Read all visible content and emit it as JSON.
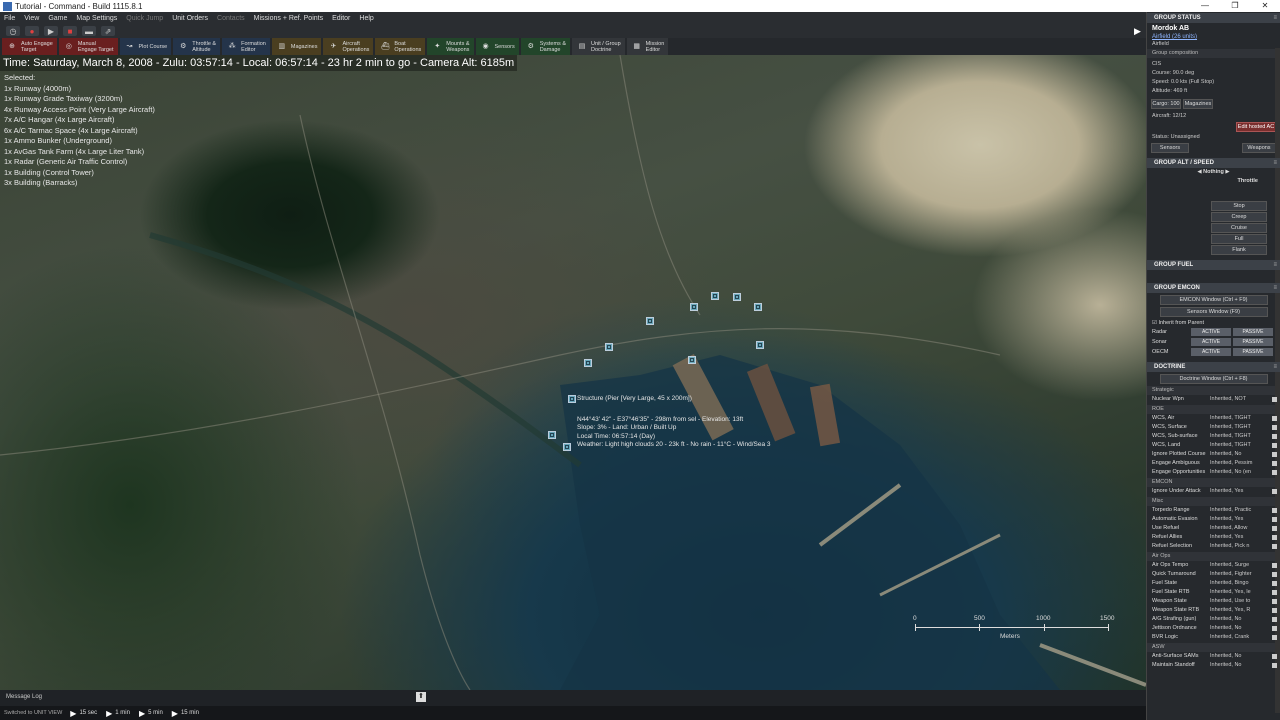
{
  "window": {
    "title": "Tutorial - Command - Build 1115.8.1",
    "controls": [
      "—",
      "❐",
      "✕"
    ]
  },
  "menu": [
    "File",
    "View",
    "Game",
    "Map Settings",
    "Quick Jump",
    "Unit Orders",
    "Contacts",
    "Missions + Ref. Points",
    "Editor",
    "Help"
  ],
  "toolbar": {
    "buttons": [
      {
        "l1": "Auto Engage",
        "l2": "Target",
        "style": "red",
        "icon": "crosshair-icon"
      },
      {
        "l1": "Manual",
        "l2": "Engage Target",
        "style": "red",
        "icon": "target-icon"
      },
      {
        "l1": "Plot Course",
        "l2": "",
        "style": "blue",
        "icon": "course-icon"
      },
      {
        "l1": "Throttle &",
        "l2": "Altitude",
        "style": "blue",
        "icon": "throttle-icon"
      },
      {
        "l1": "Formation",
        "l2": "Editor",
        "style": "blue",
        "icon": "formation-icon"
      },
      {
        "l1": "Magazines",
        "l2": "",
        "style": "brown",
        "icon": "magazine-icon"
      },
      {
        "l1": "Aircraft",
        "l2": "Operations",
        "style": "brown",
        "icon": "aircraft-icon"
      },
      {
        "l1": "Boat",
        "l2": "Operations",
        "style": "brown",
        "icon": "boat-icon"
      },
      {
        "l1": "Mounts &",
        "l2": "Weapons",
        "style": "green",
        "icon": "weapons-icon"
      },
      {
        "l1": "Sensors",
        "l2": "",
        "style": "green",
        "icon": "sensor-icon"
      },
      {
        "l1": "Systems &",
        "l2": "Damage",
        "style": "green",
        "icon": "systems-icon"
      },
      {
        "l1": "Unit / Group",
        "l2": "Doctrine",
        "style": "gray",
        "icon": "doctrine-icon"
      },
      {
        "l1": "Mission",
        "l2": "Editor",
        "style": "gray",
        "icon": "mission-icon"
      }
    ]
  },
  "map": {
    "status_line": "Time: Saturday, March 8, 2008 - Zulu: 03:57:14 - Local: 06:57:14 - 23 hr 2 min to go - Camera Alt: 6185m",
    "selected_title": "Selected:",
    "selected": [
      "1x Runway (4000m)",
      "1x Runway Grade Taxiway (3200m)",
      "4x Runway Access Point (Very Large Aircraft)",
      "7x A/C Hangar (4x Large Aircraft)",
      "6x A/C Tarmac Space (4x Large Aircraft)",
      "1x Ammo Bunker (Underground)",
      "1x AvGas Tank Farm (4x Large Liter Tank)",
      "1x Radar (Generic Air Traffic Control)",
      "1x Building (Control Tower)",
      "3x Building (Barracks)"
    ],
    "tooltip": [
      "Structure (Pier [Very Large, 45 x 200m])",
      "N44°43' 42\" - E37°46'35\" - 298m from sel - Elevation: 13ft",
      "Slope: 3% - Land: Urban / Built Up",
      "Local Time: 06:57:14 (Day)",
      "Weather: Light high clouds 20 - 23k ft - No rain - 11°C - Wind/Sea 3"
    ],
    "scale": {
      "labels": [
        "0",
        "500",
        "1000",
        "1500"
      ],
      "unit": "Meters"
    }
  },
  "bottom": {
    "message_log": "Message Log",
    "switched": "Switched to UNIT VIEW",
    "times": [
      "15 sec",
      "1 min",
      "5 min",
      "15 min"
    ]
  },
  "panel": {
    "group_status": "GROUP STATUS",
    "unit_name": "Mordok AB",
    "unit_link": "Airfield (26 units)",
    "unit_type": "Airfield",
    "group_comp": "Group composition",
    "cis": "CIS",
    "course": "Course: 90.0 deg",
    "speed": "Speed: 0.0 kts (Full Stop)",
    "altitude": "Altitude: 469 ft",
    "cargo": "Cargo: 100",
    "magazines": "Magazines",
    "aircraft": "Aircraft: 12/12",
    "edit_hosted": "Edit hosted AC",
    "status": "Status: Unassigned",
    "sensors_btn": "Sensors",
    "weapons_btn": "Weapons",
    "alt_speed": "GROUP ALT / SPEED",
    "nothing": "Nothing",
    "throttle": "Throttle",
    "speeds": [
      "Stop",
      "Creep",
      "Cruise",
      "Full",
      "Flank"
    ],
    "group_fuel": "GROUP FUEL",
    "group_emcon": "GROUP EMCON",
    "emcon_window": "EMCON Window (Ctrl + F9)",
    "sensors_window": "Sensors Window (F9)",
    "inherit_parent": "Inherit from Parent",
    "emcon_rows": [
      {
        "label": "Radar",
        "a": "ACTIVE",
        "b": "PASSIVE"
      },
      {
        "label": "Sonar",
        "a": "ACTIVE",
        "b": "PASSIVE"
      },
      {
        "label": "OECM",
        "a": "ACTIVE",
        "b": "PASSIVE"
      }
    ],
    "doctrine": "DOCTRINE",
    "doctrine_window": "Doctrine Window (Ctrl + F8)",
    "strategic": "Strategic",
    "nuclear": {
      "label": "Nuclear Wpn",
      "value": "Inherited, NOT"
    },
    "roe": "ROE",
    "roe_rows": [
      {
        "label": "WCS, Air",
        "value": "Inherited, TIGHT"
      },
      {
        "label": "WCS, Surface",
        "value": "Inherited, TIGHT"
      },
      {
        "label": "WCS, Sub-surface",
        "value": "Inherited, TIGHT"
      },
      {
        "label": "WCS, Land",
        "value": "Inherited, TIGHT"
      },
      {
        "label": "Ignore Plotted Course",
        "value": "Inherited, No"
      },
      {
        "label": "Engage Ambiguous",
        "value": "Inherited, Pessim"
      },
      {
        "label": "Engage Opportunities",
        "value": "Inherited, No (en"
      }
    ],
    "emcon_hdr": "EMCON",
    "emcon_ignore": {
      "label": "Ignore Under Attack",
      "value": "Inherited, Yes"
    },
    "misc": "Misc",
    "misc_rows": [
      {
        "label": "Torpedo Range",
        "value": "Inherited, Practic"
      },
      {
        "label": "Automatic Evasion",
        "value": "Inherited, Yes"
      },
      {
        "label": "Use Refuel",
        "value": "Inherited, Allow"
      },
      {
        "label": "Refuel Allies",
        "value": "Inherited, Yes"
      },
      {
        "label": "Refuel Selection",
        "value": "Inherited, Pick n"
      }
    ],
    "airops": "Air Ops",
    "airops_rows": [
      {
        "label": "Air Ops Tempo",
        "value": "Inherited, Surge"
      },
      {
        "label": "Quick Turnaround",
        "value": "Inherited, Fighter"
      },
      {
        "label": "Fuel State",
        "value": "Inherited, Bingo"
      },
      {
        "label": "Fuel State RTB",
        "value": "Inherited, Yes, le"
      },
      {
        "label": "Weapon State",
        "value": "Inherited, Use to"
      },
      {
        "label": "Weapon State RTB",
        "value": "Inherited, Yes, R"
      },
      {
        "label": "A/G Strafing (gun)",
        "value": "Inherited, No"
      },
      {
        "label": "Jettison Ordnance",
        "value": "Inherited, No"
      },
      {
        "label": "BVR Logic",
        "value": "Inherited, Crank"
      }
    ],
    "asw": "ASW",
    "asw_rows": [
      {
        "label": "Anti-Surface SAMs",
        "value": "Inherited, No"
      },
      {
        "label": "Maintain Standoff",
        "value": "Inherited, No"
      }
    ]
  }
}
